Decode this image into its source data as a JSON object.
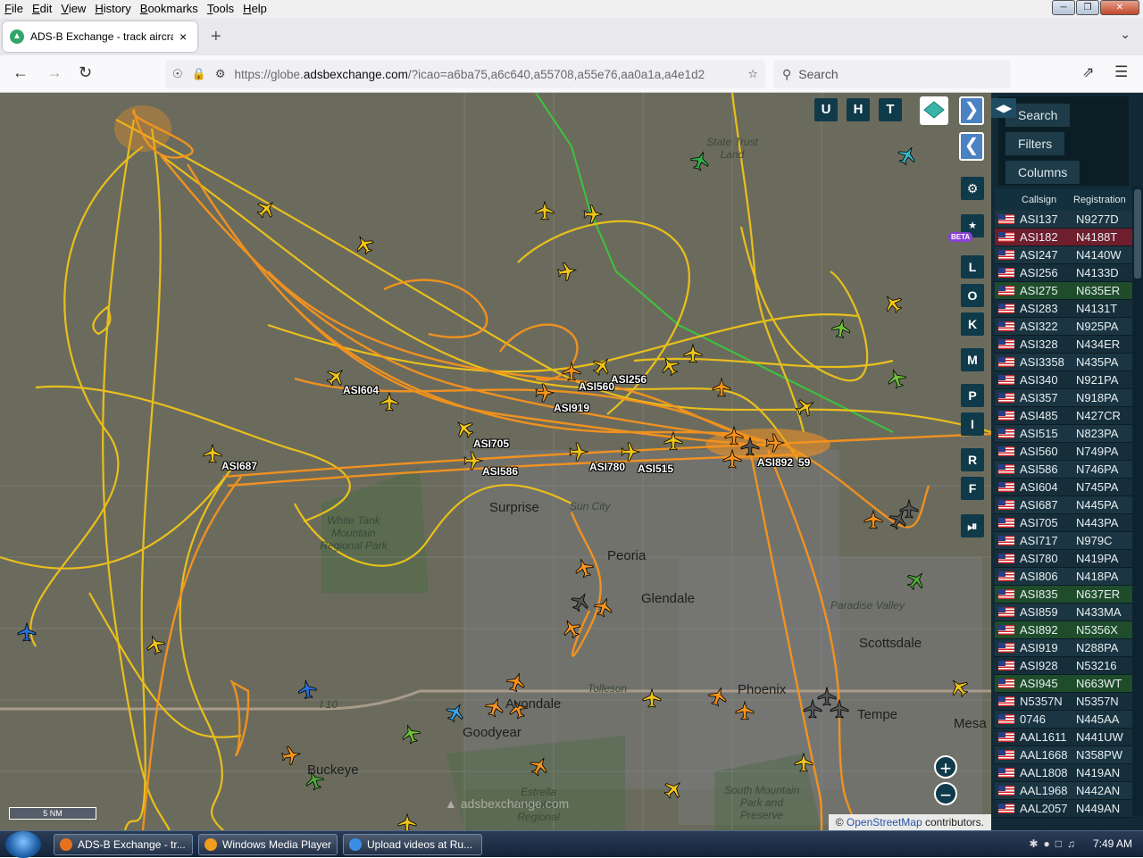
{
  "menu": [
    "File",
    "Edit",
    "View",
    "History",
    "Bookmarks",
    "Tools",
    "Help"
  ],
  "tab": {
    "title": "ADS-B Exchange - track aircraft",
    "close": "×",
    "new": "+"
  },
  "nav": {
    "url_prefix": "https://globe.",
    "url_domain": "adsbexchange.com",
    "url_rest": "/?icao=a6ba75,a6c640,a55708,a55e76,aa0a1a,a4e1d2",
    "search_placeholder": "Search"
  },
  "map": {
    "places": [
      {
        "label": "Surprise",
        "cls": ""
      },
      {
        "label": "Sun City",
        "cls": "small"
      },
      {
        "label": "Peoria",
        "cls": ""
      },
      {
        "label": "Glendale",
        "cls": ""
      },
      {
        "label": "Paradise Valley",
        "cls": "small"
      },
      {
        "label": "Scottsdale",
        "cls": ""
      },
      {
        "label": "Tolleson",
        "cls": "small"
      },
      {
        "label": "Phoenix",
        "cls": ""
      },
      {
        "label": "Tempe",
        "cls": ""
      },
      {
        "label": "Mesa",
        "cls": ""
      },
      {
        "label": "Avondale",
        "cls": ""
      },
      {
        "label": "Goodyear",
        "cls": ""
      },
      {
        "label": "Buckeye",
        "cls": ""
      },
      {
        "label": "White Tank Mountain Regional Park",
        "cls": "small"
      },
      {
        "label": "State Trust Land",
        "cls": "small"
      },
      {
        "label": "South Mountain Park and Preserve",
        "cls": "small"
      },
      {
        "label": "Estrella Mountain Regional",
        "cls": "small"
      },
      {
        "label": "I 10",
        "cls": "small"
      }
    ],
    "callsigns": [
      "ASI604",
      "ASI256",
      "ASI560",
      "ASI919",
      "ASI705",
      "ASI687",
      "ASI586",
      "ASI780",
      "ASI515",
      "ASI892",
      "59"
    ],
    "top_buttons": [
      "U",
      "H",
      "T"
    ],
    "side_buttons": [
      "L",
      "O",
      "K",
      "M",
      "P",
      "I",
      "R",
      "F"
    ],
    "beta": "BETA",
    "scale": "5 NM",
    "watermark": "adsbexchange.com",
    "attribution_prefix": "© ",
    "attribution_link": "OpenStreetMap",
    "attribution_suffix": " contributors.",
    "zoom_in": "+",
    "zoom_out": "−"
  },
  "panel": {
    "tabs": [
      "Search",
      "Filters",
      "Columns"
    ],
    "headers": [
      "Callsign",
      "Registration"
    ],
    "rows": [
      {
        "callsign": "ASI137",
        "reg": "N9277D",
        "style": ""
      },
      {
        "callsign": "ASI182",
        "reg": "N4188T",
        "style": "red"
      },
      {
        "callsign": "ASI247",
        "reg": "N4140W",
        "style": ""
      },
      {
        "callsign": "ASI256",
        "reg": "N4133D",
        "style": ""
      },
      {
        "callsign": "ASI275",
        "reg": "N635ER",
        "style": "green"
      },
      {
        "callsign": "ASI283",
        "reg": "N4131T",
        "style": ""
      },
      {
        "callsign": "ASI322",
        "reg": "N925PA",
        "style": ""
      },
      {
        "callsign": "ASI328",
        "reg": "N434ER",
        "style": ""
      },
      {
        "callsign": "ASI3358",
        "reg": "N435PA",
        "style": ""
      },
      {
        "callsign": "ASI340",
        "reg": "N921PA",
        "style": ""
      },
      {
        "callsign": "ASI357",
        "reg": "N918PA",
        "style": ""
      },
      {
        "callsign": "ASI485",
        "reg": "N427CR",
        "style": ""
      },
      {
        "callsign": "ASI515",
        "reg": "N823PA",
        "style": ""
      },
      {
        "callsign": "ASI560",
        "reg": "N749PA",
        "style": ""
      },
      {
        "callsign": "ASI586",
        "reg": "N746PA",
        "style": ""
      },
      {
        "callsign": "ASI604",
        "reg": "N745PA",
        "style": ""
      },
      {
        "callsign": "ASI687",
        "reg": "N445PA",
        "style": ""
      },
      {
        "callsign": "ASI705",
        "reg": "N443PA",
        "style": ""
      },
      {
        "callsign": "ASI717",
        "reg": "N979C",
        "style": ""
      },
      {
        "callsign": "ASI780",
        "reg": "N419PA",
        "style": ""
      },
      {
        "callsign": "ASI806",
        "reg": "N418PA",
        "style": ""
      },
      {
        "callsign": "ASI835",
        "reg": "N637ER",
        "style": "green"
      },
      {
        "callsign": "ASI859",
        "reg": "N433MA",
        "style": ""
      },
      {
        "callsign": "ASI892",
        "reg": "N5356X",
        "style": "green"
      },
      {
        "callsign": "ASI919",
        "reg": "N288PA",
        "style": ""
      },
      {
        "callsign": "ASI928",
        "reg": "N53216",
        "style": ""
      },
      {
        "callsign": "ASI945",
        "reg": "N663WT",
        "style": "green"
      },
      {
        "callsign": "N5357N",
        "reg": "N5357N",
        "style": ""
      },
      {
        "callsign": "0746",
        "reg": "N445AA",
        "style": ""
      },
      {
        "callsign": "AAL1611",
        "reg": "N441UW",
        "style": ""
      },
      {
        "callsign": "AAL1668",
        "reg": "N358PW",
        "style": ""
      },
      {
        "callsign": "AAL1808",
        "reg": "N419AN",
        "style": ""
      },
      {
        "callsign": "AAL1968",
        "reg": "N442AN",
        "style": ""
      },
      {
        "callsign": "AAL2057",
        "reg": "N449AN",
        "style": ""
      }
    ]
  },
  "taskbar": {
    "tasks": [
      {
        "label": "ADS-B Exchange - tr...",
        "color": "#e8721c"
      },
      {
        "label": "Windows Media Player",
        "color": "#f29d1e"
      },
      {
        "label": "Upload videos at Ru...",
        "color": "#3b8ee8"
      }
    ],
    "clock": "7:49 AM"
  },
  "colors": {
    "track_yellow": "#f0c419",
    "track_orange": "#f7941d",
    "panel_bg": "#122a35",
    "button_dark": "#0f3a4a"
  }
}
